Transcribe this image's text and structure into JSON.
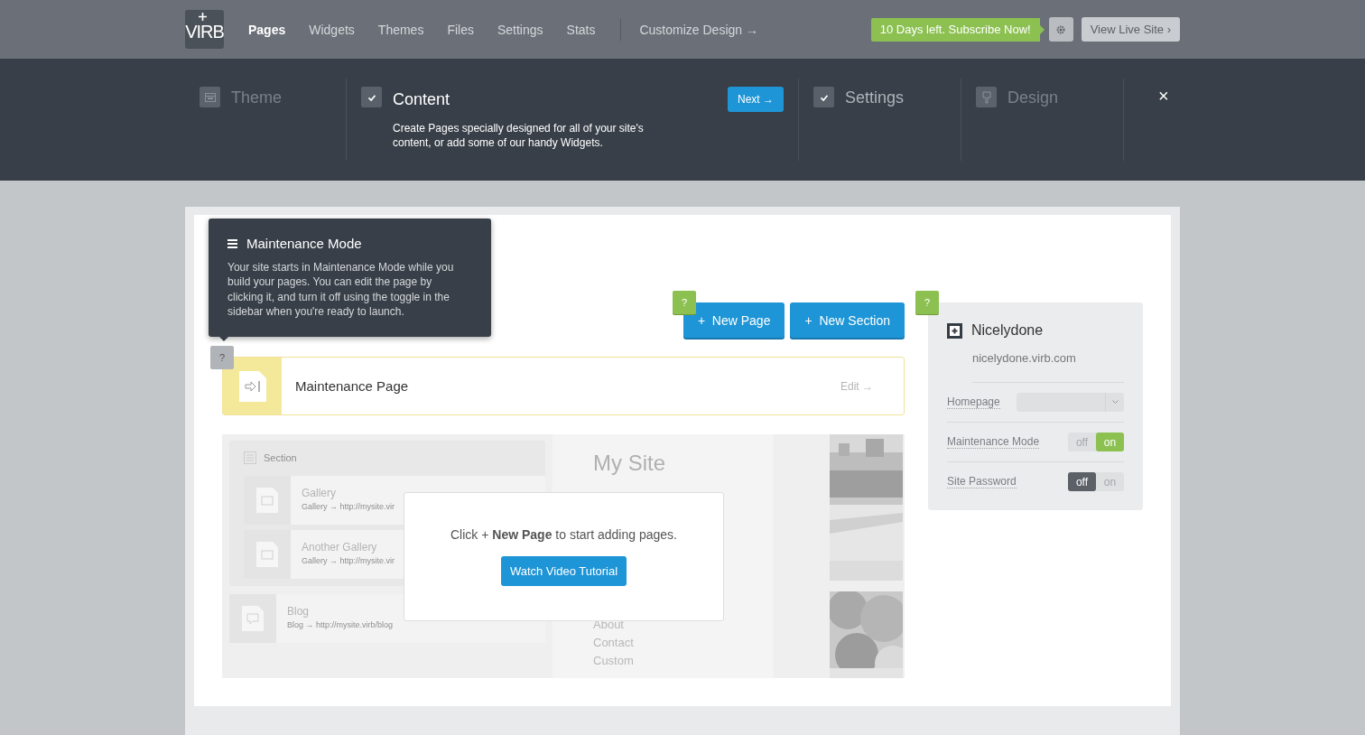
{
  "nav": {
    "logo": "VIRB",
    "items": [
      {
        "label": "Pages",
        "selected": true
      },
      {
        "label": "Widgets",
        "selected": false
      },
      {
        "label": "Themes",
        "selected": false
      },
      {
        "label": "Files",
        "selected": false
      },
      {
        "label": "Settings",
        "selected": false
      },
      {
        "label": "Stats",
        "selected": false
      }
    ],
    "customize": "Customize Design →",
    "subscribe": "10 Days left. Subscribe Now!",
    "view_live": "View Live Site ›"
  },
  "steps": [
    {
      "title": "Theme",
      "kind": "theme",
      "checked": false,
      "selected": false
    },
    {
      "title": "Content",
      "checked": true,
      "selected": true,
      "description": "Create Pages specially designed for all of your site's content, or add some of our handy Widgets.",
      "button": "Next →"
    },
    {
      "title": "Settings",
      "checked": true,
      "selected": false
    },
    {
      "title": "Design",
      "kind": "design",
      "checked": false,
      "selected": false
    }
  ],
  "close": "×",
  "tooltip": {
    "title": "Maintenance Mode",
    "text": "Your site starts in Maintenance Mode while you build your pages. You can edit the page by clicking it, and turn it off using the toggle in the sidebar when you're ready to launch.",
    "help": "?"
  },
  "actions": {
    "help": "?",
    "buttons": [
      "+  New Page",
      "+  New Section"
    ]
  },
  "maintenance_page": {
    "title": "Maintenance Page",
    "edit": "Edit →"
  },
  "preview": {
    "section": "Section",
    "pages": [
      {
        "title": "Gallery",
        "url": "Gallery → http://mysite.vir"
      },
      {
        "title": "Another Gallery",
        "url": "Gallery → http://mysite.vir"
      }
    ],
    "blog": {
      "title": "Blog",
      "url": "Blog → http://mysite.virb/blog"
    },
    "site_title": "My Site",
    "menu": [
      "About",
      "Contact",
      "Custom"
    ],
    "dialog": {
      "text": "Click + **New Page** to start adding pages.",
      "button": "Watch Video Tutorial"
    }
  },
  "sidebar": {
    "help": "?",
    "site_name": "Nicelydone",
    "url": "nicelydone.virb.com",
    "fields": [
      {
        "label": "Homepage",
        "kind": "select"
      },
      {
        "label": "Maintenance Mode",
        "kind": "toggle",
        "on": true,
        "off_label": "off",
        "on_label": "on"
      },
      {
        "label": "Site Password",
        "kind": "toggle",
        "on": false,
        "off_label": "off",
        "on_label": "on"
      }
    ]
  }
}
